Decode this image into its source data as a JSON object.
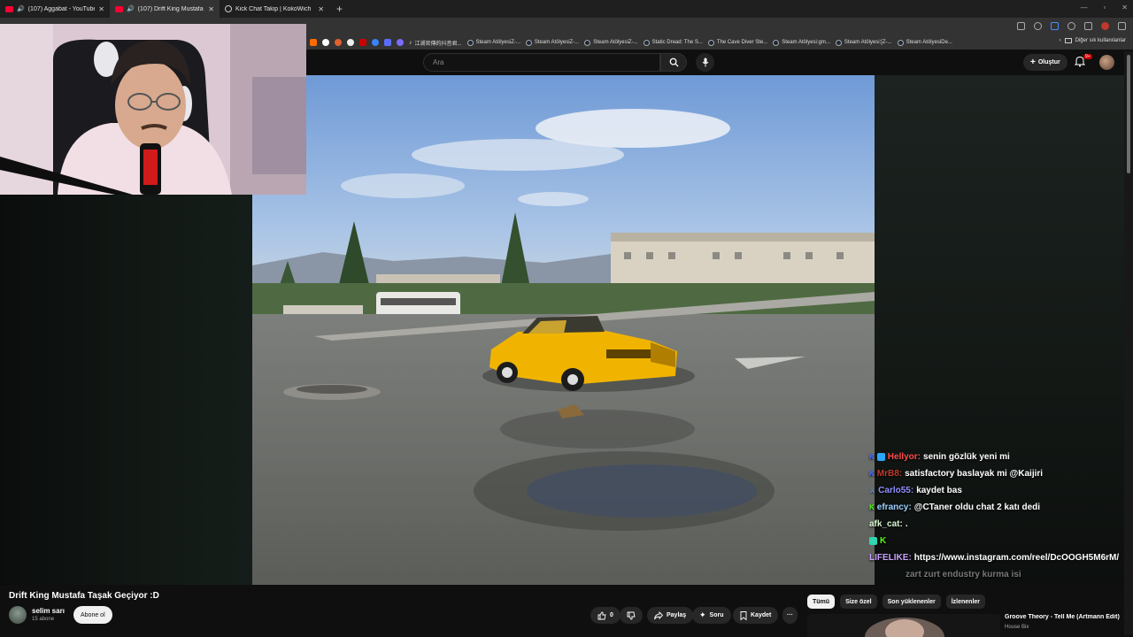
{
  "browser": {
    "tabs": [
      {
        "title": "(107) Aggabat - YouTube",
        "active": false
      },
      {
        "title": "(107) Drift King Mustafa Taşak",
        "active": true
      },
      {
        "title": "Kick Chat Takip | KokoWich",
        "active": false
      }
    ],
    "new_tab": "+",
    "window_controls": [
      "—",
      "▫",
      "✕"
    ]
  },
  "bookmarks": {
    "items": [
      "江湖官傳的抖音君...",
      "Steam AtölyesiZ-...",
      "Steam AtölyesiZ-...",
      "Steam AtölyesiZ-...",
      "Static Dread: The S...",
      "The Cave Diver Ste...",
      "Steam Atölyesi:gm...",
      "Steam Atölyesi:[Z-...",
      "Steam AtölyesiDe..."
    ],
    "more": "›",
    "other": "Diğer sık kullanılanlar"
  },
  "youtube": {
    "search_placeholder": "Ara",
    "create_label": "Oluştur",
    "notif_count": "9+",
    "video_title": "Drift King Mustafa Taşak Geçiyor :D",
    "channel_name": "selim sarı",
    "channel_subs": "15 abone",
    "subscribe_label": "Abone ol",
    "like_count": "0",
    "share_label": "Paylaş",
    "ask_label": "Soru",
    "save_label": "Kaydet",
    "more_label": "···",
    "chips": [
      "Tümü",
      "Size özel",
      "Son yüklenenler",
      "İzlenenler"
    ],
    "rec_title": "Groove Theory - Tell Me (Artmann Edit)",
    "rec_channel": "House Bix"
  },
  "chat": {
    "messages": [
      {
        "user": "Hellyor:",
        "text": "senin gözlük yeni mi",
        "color": "#ff4d4d"
      },
      {
        "user": "MrB8:",
        "text": "satisfactory baslayak mi @Kaijiri",
        "color": "#c0392b"
      },
      {
        "user": "Carlo55:",
        "text": "kaydet bas",
        "color": "#8f8fff"
      },
      {
        "user": "efrancy:",
        "text": "@CTaner oldu chat 2 katı dedi",
        "color": "#9ad0ff"
      },
      {
        "user": "afk_cat:",
        "text": ".",
        "color": "#d7f5d0"
      },
      {
        "user": "K",
        "text": "",
        "color": "#53fc18"
      },
      {
        "user": "LIFELIKE:",
        "text": "https://www.instagram.com/reel/DcOOGH5M6rM/",
        "color": "#c9a0ff"
      },
      {
        "user": "",
        "text": "zart zurt endustry kurma isi",
        "color": "#555555"
      }
    ]
  },
  "colors": {
    "accent_red": "#ff0033",
    "kick_green": "#53fc18",
    "bg": "#0f0f0f"
  },
  "icons": [
    "audio-icon",
    "close-icon",
    "globe-icon",
    "search-icon",
    "mic-icon",
    "plus-icon",
    "bell-icon",
    "like-icon",
    "dislike-icon",
    "share-icon",
    "sparkle-icon",
    "save-icon",
    "steam-icon",
    "folder-icon"
  ]
}
